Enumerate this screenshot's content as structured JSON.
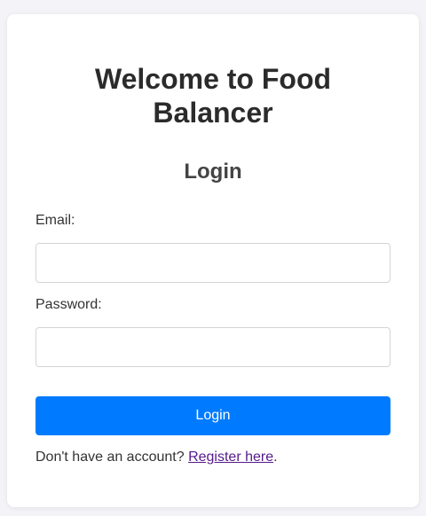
{
  "page": {
    "title": "Welcome to Food Balancer",
    "subtitle": "Login"
  },
  "form": {
    "email_label": "Email:",
    "email_value": "",
    "email_placeholder": "",
    "password_label": "Password:",
    "password_value": "",
    "password_placeholder": "",
    "submit_label": "Login"
  },
  "footer": {
    "prompt_text": "Don't have an account? ",
    "register_link_text": "Register here",
    "trailing_text": "."
  },
  "colors": {
    "background": "#f4f4f8",
    "card": "#ffffff",
    "primary_button": "#007bff",
    "link_visited": "#551a8b",
    "text": "#333333"
  }
}
